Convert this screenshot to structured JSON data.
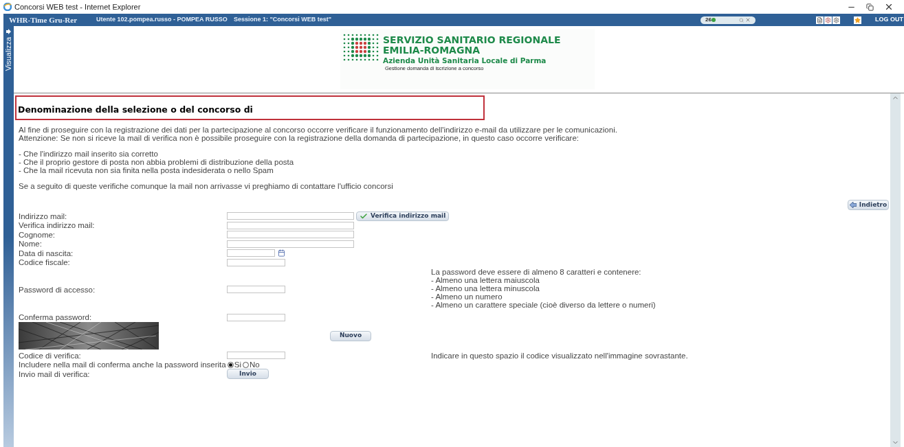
{
  "browser": {
    "title": "Concorsi WEB test - Internet Explorer"
  },
  "app_bar": {
    "app_name": "WHR-Time Gru-Rer",
    "user": "Utente 102.pompea.russo - POMPEA RUSSO",
    "session": "Sessione 1: \"Concorsi WEB test\"",
    "counter": "26",
    "logout": "LOG OUT"
  },
  "sidebar": {
    "label": "Visualizza"
  },
  "header": {
    "logo_lines": [
      "SERVIZIO SANITARIO REGIONALE",
      "EMILIA-ROMAGNA"
    ],
    "logo_subline": "Azienda Unità Sanitaria Locale di Parma",
    "subtitle": "Gestione domanda di iscrizione a concorso"
  },
  "section_title": "Denominazione della selezione o del concorso di",
  "intro": [
    "Al fine di proseguire con la registrazione dei dati per la partecipazione al concorso occorre verificare il funzionamento dell'indirizzo e-mail da utilizzare per le comunicazioni.",
    "Attenzione: Se non si riceve la mail di verifica non è possibile proseguire con la registrazione della domanda di partecipazione, in questo caso occorre verificare:"
  ],
  "checks": [
    "- Che l'indirizzo mail inserito sia corretto",
    "- Che il proprio gestore di posta non abbia problemi di distribuzione della posta",
    "- Che la mail ricevuta non sia finita nella posta indesiderata o nello Spam"
  ],
  "contact_note": "Se a seguito di queste verifiche comunque la mail non arrivasse vi preghiamo di contattare l'ufficio concorsi",
  "back_button": "Indietro",
  "fields": [
    {
      "kind": "wide",
      "label": "Indirizzo mail:",
      "action": "Verifica indirizzo mail"
    },
    {
      "kind": "wide",
      "label": "Verifica indirizzo mail:"
    },
    {
      "kind": "wide",
      "label": "Cognome:"
    },
    {
      "kind": "wide",
      "label": "Nome:"
    },
    {
      "kind": "date",
      "label": "Data di nascita:"
    },
    {
      "kind": "short",
      "label": "Codice fiscale:"
    }
  ],
  "password": {
    "label": "Password di accesso:",
    "confirm_label": "Conferma password:",
    "rules_title": "La password deve essere di almeno 8 caratteri e contenere:",
    "rules": [
      "- Almeno una lettera maiuscola",
      "- Almeno una lettera minuscola",
      "- Almeno un numero",
      "- Almeno un carattere speciale (cioè diverso da lettere o numeri)"
    ]
  },
  "captcha": {
    "new_button": "Nuovo",
    "label": "Codice di verifica:",
    "hint": "Indicare in questo spazio il codice visualizzato nell'immagine sovrastante."
  },
  "include_password": {
    "label": "Includere nella mail di conferma anche la password inserita",
    "options": [
      {
        "label": "Si",
        "selected": true
      },
      {
        "label": "No",
        "selected": false
      }
    ]
  },
  "send": {
    "label": "Invio mail di verifica:",
    "button": "Invio"
  }
}
